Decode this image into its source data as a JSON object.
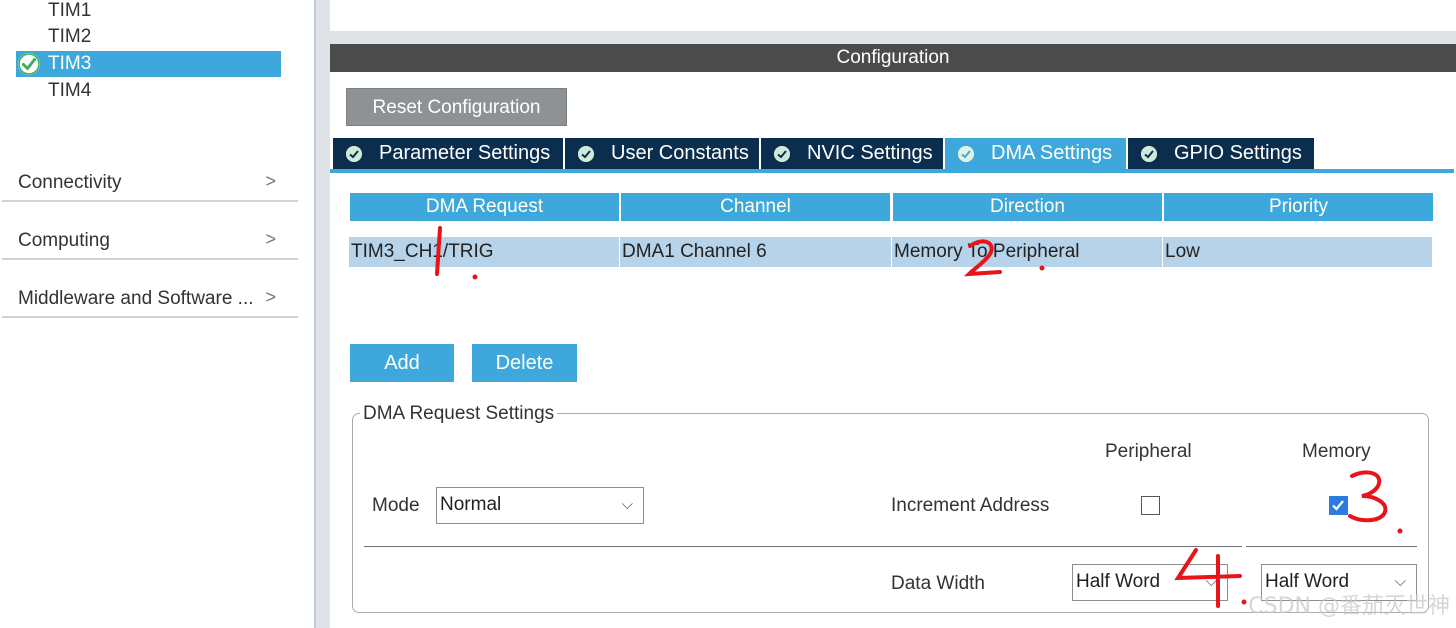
{
  "sidebar": {
    "timers": [
      {
        "label": "TIM1",
        "selected": false
      },
      {
        "label": "TIM2",
        "selected": false
      },
      {
        "label": "TIM3",
        "selected": true
      },
      {
        "label": "TIM4",
        "selected": false
      }
    ],
    "categories": [
      {
        "label": "Connectivity"
      },
      {
        "label": "Computing"
      },
      {
        "label": "Middleware and Software ..."
      }
    ],
    "chevron": ">"
  },
  "config": {
    "title": "Configuration",
    "reset_label": "Reset Configuration",
    "tabs": [
      {
        "label": "Parameter Settings",
        "active": false
      },
      {
        "label": "User Constants",
        "active": false
      },
      {
        "label": "NVIC Settings",
        "active": false
      },
      {
        "label": "DMA Settings",
        "active": true
      },
      {
        "label": "GPIO Settings",
        "active": false
      }
    ]
  },
  "dma_table": {
    "headers": [
      "DMA Request",
      "Channel",
      "Direction",
      "Priority"
    ],
    "rows": [
      [
        "TIM3_CH1/TRIG",
        "DMA1 Channel 6",
        "Memory To Peripheral",
        "Low"
      ]
    ]
  },
  "buttons": {
    "add": "Add",
    "delete": "Delete"
  },
  "request_settings": {
    "title": "DMA Request Settings",
    "mode_label": "Mode",
    "mode_value": "Normal",
    "peripheral_label": "Peripheral",
    "memory_label": "Memory",
    "increment_label": "Increment Address",
    "increment_peripheral": false,
    "increment_memory": true,
    "data_width_label": "Data Width",
    "data_width_peripheral": "Half Word",
    "data_width_memory": "Half Word"
  },
  "annotations": [
    "1.",
    "2.",
    "3.",
    "4."
  ],
  "watermark": "CSDN @番茄灭世神",
  "colors": {
    "accent": "#3ea8dc",
    "tab_dark": "#0b2d4e",
    "row": "#b6d3ea",
    "annotation": "#e8141c"
  }
}
